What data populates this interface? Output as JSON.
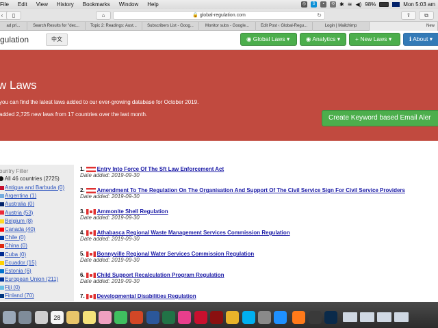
{
  "menubar": {
    "items": [
      "File",
      "Edit",
      "View",
      "History",
      "Bookmarks",
      "Window",
      "Help"
    ],
    "battery": "98%",
    "clock": "Mon 5:03 am"
  },
  "browser": {
    "url": "global-regulation.com",
    "tabs": [
      "ad pri...",
      "Search Results for \"dec...",
      "Topic 2: Readings: Aust...",
      "Subscribers List - Goog...",
      "Monitor subs - Google...",
      "Edit Post ‹ Global-Regu...",
      "Login | Mailchimp",
      "New"
    ]
  },
  "navbar": {
    "logo": "gulation",
    "lang": "中文",
    "buttons": [
      "Global Laws",
      "Analytics",
      "New Laws",
      "About"
    ]
  },
  "hero": {
    "title": "w Laws",
    "line1": "you can find the latest laws added to our ever-growing database for October 2019.",
    "line2": "added 2,725 new laws from 17 countries over the last month.",
    "alert_button": "Create Keyword based Email Aler"
  },
  "sidebar": {
    "title": "ountry Filter",
    "all": "All 46 countries (2725)",
    "countries": [
      {
        "name": "Antigua and Barbuda (0)",
        "color": "#c8102e"
      },
      {
        "name": "Argentina (1)",
        "color": "#74acdf"
      },
      {
        "name": "Australia (0)",
        "color": "#012169"
      },
      {
        "name": "Austria (53)",
        "color": "#ed2939"
      },
      {
        "name": "Belgium (8)",
        "color": "#fdda24"
      },
      {
        "name": "Canada (40)",
        "color": "#ff0000"
      },
      {
        "name": "Chile (0)",
        "color": "#0039a6"
      },
      {
        "name": "China (0)",
        "color": "#de2910"
      },
      {
        "name": "Cuba (0)",
        "color": "#002a8f"
      },
      {
        "name": "Ecuador (15)",
        "color": "#ffd100"
      },
      {
        "name": "Estonia (6)",
        "color": "#0072ce"
      },
      {
        "name": "European Union (211)",
        "color": "#003399"
      },
      {
        "name": "Fiji (0)",
        "color": "#68bfe5"
      },
      {
        "name": "Finland (70)",
        "color": "#003580"
      }
    ]
  },
  "laws": [
    {
      "num": "1.",
      "flag": "at",
      "title": "Entry Into Force Of The Sft Law Enforcement Act",
      "date": "Date added: 2019-09-30"
    },
    {
      "num": "2.",
      "flag": "at",
      "title": "Amendment To The Regulation On The Organisation And Support Of The Civil Service Sign For Civil Service Providers",
      "date": "Date added: 2019-09-30"
    },
    {
      "num": "3.",
      "flag": "ca",
      "title": "Ammonite Shell Regulation",
      "date": "Date added: 2019-09-30"
    },
    {
      "num": "4.",
      "flag": "ca",
      "title": "Athabasca Regional Waste Management Services Commission Regulation",
      "date": "Date added: 2019-09-30"
    },
    {
      "num": "5.",
      "flag": "ca",
      "title": "Bonnyville Regional Water Services Commission Regulation",
      "date": "Date added: 2019-09-30"
    },
    {
      "num": "6.",
      "flag": "ca",
      "title": "Child Support Recalculation Program Regulation",
      "date": "Date added: 2019-09-30"
    },
    {
      "num": "7.",
      "flag": "ca",
      "title": "Developmental Disabilities Regulation",
      "date": ""
    }
  ],
  "dock": {
    "calendar_day": "28",
    "icons": [
      "finder-icon",
      "launchpad-icon",
      "preview-icon",
      "calendar-icon",
      "notes-icon",
      "stickies-icon",
      "photos-icon",
      "facetime-icon",
      "powerpoint-icon",
      "word-icon",
      "excel-icon",
      "itunes-icon",
      "acrobat-icon",
      "acrobat-pro-icon",
      "chrome-icon",
      "skype-icon",
      "system-prefs-icon",
      "safari-icon",
      "firefox-icon",
      "quicktime-icon",
      "photoshop-icon",
      "window-thumb-1",
      "window-thumb-2",
      "window-thumb-3",
      "window-thumb-4"
    ]
  }
}
